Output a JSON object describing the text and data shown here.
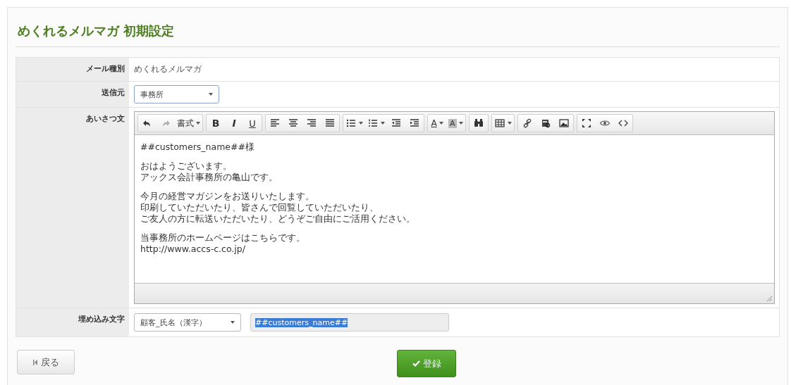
{
  "title": "めくれるメルマガ 初期設定",
  "form": {
    "rows": [
      {
        "kind": "text",
        "label": "メール種別",
        "value": "めくれるメルマガ"
      },
      {
        "kind": "select",
        "label": "送信元",
        "value": "事務所"
      },
      {
        "kind": "editor",
        "label": "あいさつ文"
      },
      {
        "kind": "embed",
        "label": "埋め込み文字",
        "select_value": "顧客_氏名（漢字）",
        "input_value": "##customers_name##",
        "text_selected": true
      }
    ]
  },
  "editor": {
    "toolbar": [
      [
        {
          "kind": "undo",
          "disabled": false
        },
        {
          "kind": "redo",
          "disabled": true
        },
        {
          "kind": "format",
          "label": "書式",
          "dropdown": true,
          "disabled": false
        }
      ],
      [
        {
          "kind": "bold",
          "label": "B",
          "disabled": false
        },
        {
          "kind": "italic",
          "label": "I",
          "disabled": false
        },
        {
          "kind": "underline",
          "label": "U",
          "disabled": false
        }
      ],
      [
        {
          "kind": "alignleft",
          "disabled": false
        },
        {
          "kind": "aligncenter",
          "disabled": false
        },
        {
          "kind": "alignright",
          "disabled": false
        },
        {
          "kind": "justify",
          "disabled": false
        }
      ],
      [
        {
          "kind": "bullets",
          "dropdown": true,
          "disabled": false
        },
        {
          "kind": "numbers",
          "dropdown": true,
          "disabled": false
        },
        {
          "kind": "outdent",
          "disabled": false
        },
        {
          "kind": "indent",
          "disabled": false
        }
      ],
      [
        {
          "kind": "textcolor",
          "label": "A",
          "dropdown": true,
          "disabled": false
        },
        {
          "kind": "backcolor",
          "label": "A",
          "dropdown": true,
          "disabled": false
        }
      ],
      [
        {
          "kind": "find",
          "disabled": false
        }
      ],
      [
        {
          "kind": "table",
          "dropdown": true,
          "disabled": false
        }
      ],
      [
        {
          "kind": "link",
          "disabled": false
        },
        {
          "kind": "anchor",
          "disabled": false
        },
        {
          "kind": "image",
          "disabled": false
        }
      ],
      [
        {
          "kind": "fullscreen",
          "disabled": false
        },
        {
          "kind": "preview",
          "disabled": false
        },
        {
          "kind": "code",
          "disabled": false
        }
      ]
    ],
    "paragraphs": [
      [
        "##customers_name##様"
      ],
      [
        "おはようございます。",
        "アックス会計事務所の亀山です。"
      ],
      [
        "今月の経営マガジンをお送りいたします。",
        "印刷していただいたり、皆さんで回覧していただいたり、",
        "ご友人の方に転送いただいたり、どうぞご自由にご活用ください。"
      ],
      [
        "当事務所のホームページはこちらです。",
        "http://www.accs-c.co.jp/"
      ]
    ]
  },
  "buttons": [
    {
      "kind": "back",
      "label": "戻る"
    },
    {
      "kind": "submit",
      "label": "登録"
    }
  ]
}
